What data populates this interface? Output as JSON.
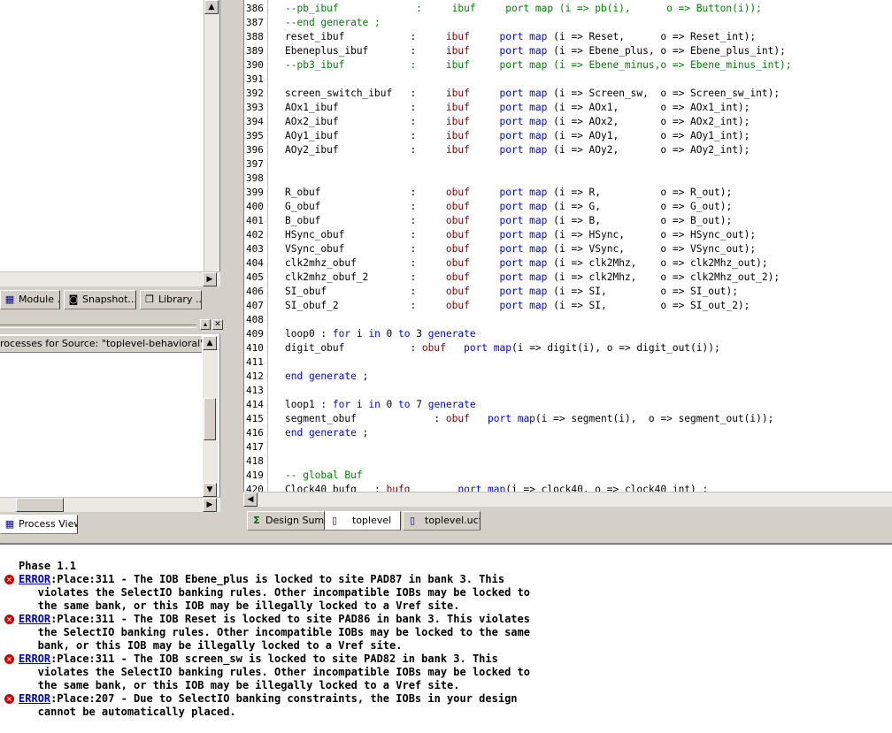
{
  "left_tabs": [
    {
      "label": "Module ...",
      "icon": "module-icon"
    },
    {
      "label": "Snapshot...",
      "icon": "camera-icon"
    },
    {
      "label": "Library ...",
      "icon": "library-icon"
    }
  ],
  "processes_label": "rocesses for Source:  \"toplevel-behavioral\"",
  "process_view_tab": "Process View",
  "editor_tabs": [
    {
      "label": "Design Sum...",
      "icon": "sigma-icon"
    },
    {
      "label": "toplevel",
      "icon": "vhdl-file-icon"
    },
    {
      "label": "toplevel.ucf",
      "icon": "ucf-file-icon"
    }
  ],
  "code_lines": [
    {
      "n": "386",
      "segs": [
        [
          "cm",
          "--pb_ibuf             :     ibuf     port map (i => pb(i),      o => Button(i));"
        ]
      ]
    },
    {
      "n": "387",
      "segs": [
        [
          "cm",
          "--end generate ;"
        ]
      ]
    },
    {
      "n": "388",
      "segs": [
        [
          "",
          "reset_ibuf           :     "
        ],
        [
          "ty",
          "ibuf"
        ],
        [
          "",
          "     "
        ],
        [
          "kw",
          "port map"
        ],
        [
          "",
          " (i => Reset,      o => Reset_int);"
        ]
      ]
    },
    {
      "n": "389",
      "segs": [
        [
          "",
          "Ebeneplus_ibuf       :     "
        ],
        [
          "ty",
          "ibuf"
        ],
        [
          "",
          "     "
        ],
        [
          "kw",
          "port map"
        ],
        [
          "",
          " (i => Ebene_plus, o => Ebene_plus_int);"
        ]
      ]
    },
    {
      "n": "390",
      "segs": [
        [
          "cm",
          "--pb3_ibuf           :     ibuf     port map (i => Ebene_minus,o => Ebene_minus_int);"
        ]
      ]
    },
    {
      "n": "391",
      "segs": [
        [
          "",
          ""
        ]
      ]
    },
    {
      "n": "392",
      "segs": [
        [
          "",
          "screen_switch_ibuf   :     "
        ],
        [
          "ty",
          "ibuf"
        ],
        [
          "",
          "     "
        ],
        [
          "kw",
          "port map"
        ],
        [
          "",
          " (i => Screen_sw,  o => Screen_sw_int);"
        ]
      ]
    },
    {
      "n": "393",
      "segs": [
        [
          "",
          "AOx1_ibuf            :     "
        ],
        [
          "ty",
          "ibuf"
        ],
        [
          "",
          "     "
        ],
        [
          "kw",
          "port map"
        ],
        [
          "",
          " (i => AOx1,       o => AOx1_int);"
        ]
      ]
    },
    {
      "n": "394",
      "segs": [
        [
          "",
          "AOx2_ibuf            :     "
        ],
        [
          "ty",
          "ibuf"
        ],
        [
          "",
          "     "
        ],
        [
          "kw",
          "port map"
        ],
        [
          "",
          " (i => AOx2,       o => AOx2_int);"
        ]
      ]
    },
    {
      "n": "395",
      "segs": [
        [
          "",
          "AOy1_ibuf            :     "
        ],
        [
          "ty",
          "ibuf"
        ],
        [
          "",
          "     "
        ],
        [
          "kw",
          "port map"
        ],
        [
          "",
          " (i => AOy1,       o => AOy1_int);"
        ]
      ]
    },
    {
      "n": "396",
      "segs": [
        [
          "",
          "AOy2_ibuf            :     "
        ],
        [
          "ty",
          "ibuf"
        ],
        [
          "",
          "     "
        ],
        [
          "kw",
          "port map"
        ],
        [
          "",
          " (i => AOy2,       o => AOy2_int);"
        ]
      ]
    },
    {
      "n": "397",
      "segs": [
        [
          "",
          ""
        ]
      ]
    },
    {
      "n": "398",
      "segs": [
        [
          "",
          ""
        ]
      ]
    },
    {
      "n": "399",
      "segs": [
        [
          "",
          "R_obuf               :     "
        ],
        [
          "ty",
          "obuf"
        ],
        [
          "",
          "     "
        ],
        [
          "kw",
          "port map"
        ],
        [
          "",
          " (i => R,          o => R_out);"
        ]
      ]
    },
    {
      "n": "400",
      "segs": [
        [
          "",
          "G_obuf               :     "
        ],
        [
          "ty",
          "obuf"
        ],
        [
          "",
          "     "
        ],
        [
          "kw",
          "port map"
        ],
        [
          "",
          " (i => G,          o => G_out);"
        ]
      ]
    },
    {
      "n": "401",
      "segs": [
        [
          "",
          "B_obuf               :     "
        ],
        [
          "ty",
          "obuf"
        ],
        [
          "",
          "     "
        ],
        [
          "kw",
          "port map"
        ],
        [
          "",
          " (i => B,          o => B_out);"
        ]
      ]
    },
    {
      "n": "402",
      "segs": [
        [
          "",
          "HSync_obuf           :     "
        ],
        [
          "ty",
          "obuf"
        ],
        [
          "",
          "     "
        ],
        [
          "kw",
          "port map"
        ],
        [
          "",
          " (i => HSync,      o => HSync_out);"
        ]
      ]
    },
    {
      "n": "403",
      "segs": [
        [
          "",
          "VSync_obuf           :     "
        ],
        [
          "ty",
          "obuf"
        ],
        [
          "",
          "     "
        ],
        [
          "kw",
          "port map"
        ],
        [
          "",
          " (i => VSync,      o => VSync_out);"
        ]
      ]
    },
    {
      "n": "404",
      "segs": [
        [
          "",
          "clk2mhz_obuf         :     "
        ],
        [
          "ty",
          "obuf"
        ],
        [
          "",
          "     "
        ],
        [
          "kw",
          "port map"
        ],
        [
          "",
          " (i => clk2Mhz,    o => clk2Mhz_out);"
        ]
      ]
    },
    {
      "n": "405",
      "segs": [
        [
          "",
          "clk2mhz_obuf_2       :     "
        ],
        [
          "ty",
          "obuf"
        ],
        [
          "",
          "     "
        ],
        [
          "kw",
          "port map"
        ],
        [
          "",
          " (i => clk2Mhz,    o => clk2Mhz_out_2);"
        ]
      ]
    },
    {
      "n": "406",
      "segs": [
        [
          "",
          "SI_obuf              :     "
        ],
        [
          "ty",
          "obuf"
        ],
        [
          "",
          "     "
        ],
        [
          "kw",
          "port map"
        ],
        [
          "",
          " (i => SI,         o => SI_out);"
        ]
      ]
    },
    {
      "n": "407",
      "segs": [
        [
          "",
          "SI_obuf_2            :     "
        ],
        [
          "ty",
          "obuf"
        ],
        [
          "",
          "     "
        ],
        [
          "kw",
          "port map"
        ],
        [
          "",
          " (i => SI,         o => SI_out_2);"
        ]
      ]
    },
    {
      "n": "408",
      "segs": [
        [
          "",
          ""
        ]
      ]
    },
    {
      "n": "409",
      "segs": [
        [
          "",
          "loop0 : "
        ],
        [
          "kw",
          "for"
        ],
        [
          "",
          " i "
        ],
        [
          "kw",
          "in"
        ],
        [
          "",
          " 0 "
        ],
        [
          "kw",
          "to"
        ],
        [
          "",
          " 3 "
        ],
        [
          "kw",
          "generate"
        ]
      ]
    },
    {
      "n": "410",
      "segs": [
        [
          "",
          "digit_obuf           : "
        ],
        [
          "ty",
          "obuf"
        ],
        [
          "",
          "   "
        ],
        [
          "kw",
          "port map"
        ],
        [
          "",
          "(i => digit(i), o => digit_out(i));"
        ]
      ]
    },
    {
      "n": "411",
      "segs": [
        [
          "",
          ""
        ]
      ]
    },
    {
      "n": "412",
      "segs": [
        [
          "kw",
          "end generate"
        ],
        [
          "",
          " ;"
        ]
      ]
    },
    {
      "n": "413",
      "segs": [
        [
          "",
          ""
        ]
      ]
    },
    {
      "n": "414",
      "segs": [
        [
          "",
          "loop1 : "
        ],
        [
          "kw",
          "for"
        ],
        [
          "",
          " i "
        ],
        [
          "kw",
          "in"
        ],
        [
          "",
          " 0 "
        ],
        [
          "kw",
          "to"
        ],
        [
          "",
          " 7 "
        ],
        [
          "kw",
          "generate"
        ]
      ]
    },
    {
      "n": "415",
      "segs": [
        [
          "",
          "segment_obuf             : "
        ],
        [
          "ty",
          "obuf"
        ],
        [
          "",
          "   "
        ],
        [
          "kw",
          "port map"
        ],
        [
          "",
          "(i => segment(i),  o => segment_out(i));"
        ]
      ]
    },
    {
      "n": "416",
      "segs": [
        [
          "kw",
          "end generate"
        ],
        [
          "",
          " ;"
        ]
      ]
    },
    {
      "n": "417",
      "segs": [
        [
          "",
          ""
        ]
      ]
    },
    {
      "n": "418",
      "segs": [
        [
          "",
          ""
        ]
      ]
    },
    {
      "n": "419",
      "segs": [
        [
          "cm",
          "-- global Buf"
        ]
      ]
    },
    {
      "n": "420",
      "segs": [
        [
          "",
          "Clock40_bufg   : "
        ],
        [
          "ty",
          "bufg"
        ],
        [
          "",
          "        "
        ],
        [
          "kw",
          "port map"
        ],
        [
          "",
          "(i => clock40, o => clock40_int) ;"
        ]
      ]
    }
  ],
  "console": {
    "phase": "Phase 1.1",
    "errors": [
      {
        "tag": "ERROR",
        "lines": [
          ":Place:311 - The IOB Ebene_plus is locked to site PAD87 in bank 3. This",
          "   violates the SelectIO banking rules. Other incompatible IOBs may be locked to",
          "   the same bank, or this IOB may be illegally locked to a Vref site."
        ]
      },
      {
        "tag": "ERROR",
        "lines": [
          ":Place:311 - The IOB Reset is locked to site PAD86 in bank 3. This violates",
          "   the SelectIO banking rules. Other incompatible IOBs may be locked to the same",
          "   bank, or this IOB may be illegally locked to a Vref site."
        ]
      },
      {
        "tag": "ERROR",
        "lines": [
          ":Place:311 - The IOB screen_sw is locked to site PAD82 in bank 3. This",
          "   violates the SelectIO banking rules. Other incompatible IOBs may be locked to",
          "   the same bank, or this IOB may be illegally locked to a Vref site."
        ]
      },
      {
        "tag": "ERROR",
        "lines": [
          ":Place:207 - Due to SelectIO banking constraints, the IOBs in your design",
          "   cannot be automatically placed."
        ]
      }
    ]
  }
}
